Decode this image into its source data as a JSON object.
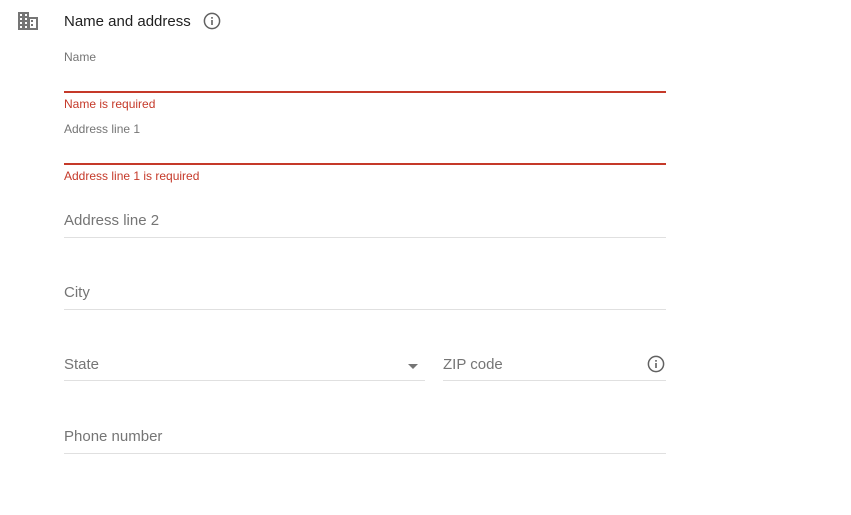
{
  "section": {
    "title": "Name and address",
    "icon": "domain-icon",
    "info_icon": "info-icon"
  },
  "colors": {
    "error": "#c53929",
    "label": "#757575",
    "divider": "#e0e0e0"
  },
  "fields": {
    "name": {
      "label": "Name",
      "value": "",
      "error": "Name is required"
    },
    "address1": {
      "label": "Address line 1",
      "value": "",
      "error": "Address line 1 is required"
    },
    "address2": {
      "label": "Address line 2",
      "value": ""
    },
    "city": {
      "label": "City",
      "value": ""
    },
    "state": {
      "label": "State",
      "value": "",
      "dropdown_icon": "arrow-drop-down-icon"
    },
    "zip": {
      "label": "ZIP code",
      "value": "",
      "info_icon": "info-icon"
    },
    "phone": {
      "label": "Phone number",
      "value": ""
    }
  }
}
